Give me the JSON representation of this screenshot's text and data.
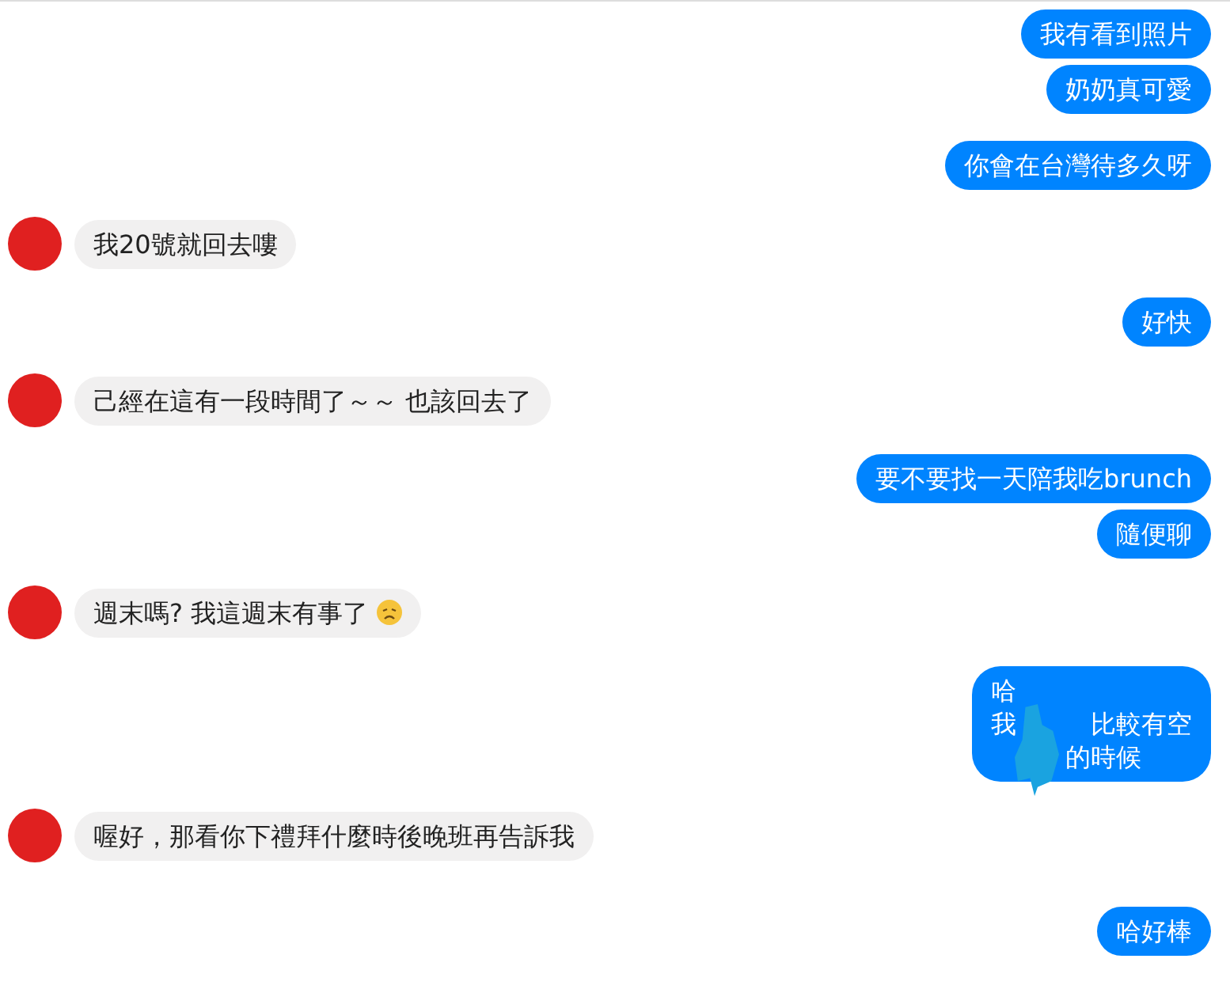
{
  "groups": [
    {
      "kind": "sent",
      "messages": [
        {
          "lines": [
            [
              {
                "text": "我有看到照片"
              }
            ]
          ]
        },
        {
          "lines": [
            [
              {
                "text": "奶奶真可愛"
              }
            ]
          ]
        }
      ]
    },
    {
      "kind": "sent",
      "messages": [
        {
          "lines": [
            [
              {
                "text": "你會在台灣待多久呀"
              }
            ]
          ]
        }
      ]
    },
    {
      "kind": "received",
      "messages": [
        {
          "lines": [
            [
              {
                "text": "我20號就回去嘍"
              }
            ]
          ]
        }
      ]
    },
    {
      "kind": "sent",
      "messages": [
        {
          "lines": [
            [
              {
                "text": "好快"
              }
            ]
          ]
        }
      ]
    },
    {
      "kind": "received",
      "messages": [
        {
          "lines": [
            [
              {
                "text": "己經在這有一段時間了～～ 也該回去了"
              }
            ]
          ]
        }
      ]
    },
    {
      "kind": "sent",
      "messages": [
        {
          "lines": [
            [
              {
                "text": "要不要找一天陪我吃brunch"
              }
            ]
          ]
        },
        {
          "lines": [
            [
              {
                "text": "隨便聊"
              }
            ]
          ]
        }
      ]
    },
    {
      "kind": "received",
      "messages": [
        {
          "lines": [
            [
              {
                "text": "週末嗎? 我這週末有事了"
              },
              {
                "kind": "sad_emoji"
              }
            ]
          ]
        }
      ]
    },
    {
      "kind": "sent",
      "messages": [
        {
          "redacted": true,
          "lines": [
            [
              {
                "text": "哈"
              }
            ],
            [
              {
                "text": "我"
              },
              {
                "kind": "redacted"
              },
              {
                "text": "比較有空"
              }
            ],
            [
              {
                "kind": "redacted"
              },
              {
                "text": "的時候"
              }
            ]
          ]
        }
      ]
    },
    {
      "kind": "received",
      "messages": [
        {
          "lines": [
            [
              {
                "text": "喔好，那看你下禮拜什麼時後晚班再告訴我"
              }
            ]
          ]
        }
      ]
    },
    {
      "kind": "sent",
      "messages": [
        {
          "lines": [
            [
              {
                "text": "哈好棒"
              }
            ]
          ]
        }
      ]
    }
  ]
}
